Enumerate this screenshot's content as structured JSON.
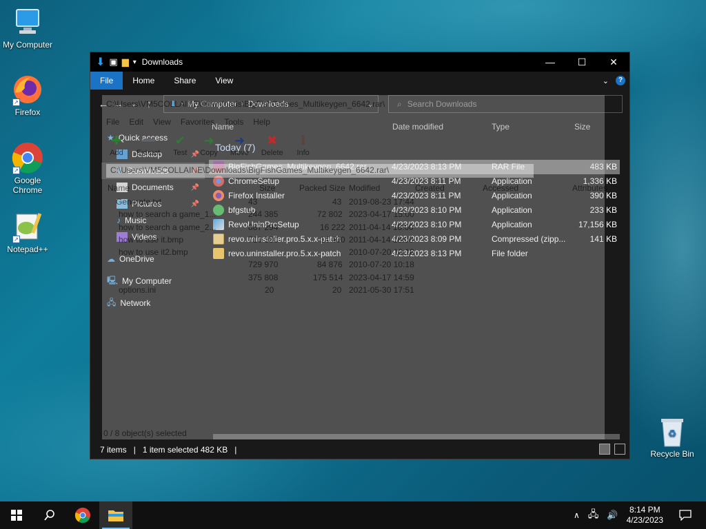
{
  "desktop": {
    "icons": [
      {
        "label": "My Computer"
      },
      {
        "label": "Firefox"
      },
      {
        "label": "Google Chrome"
      },
      {
        "label": "Notepad++"
      }
    ],
    "recycle_bin": "Recycle Bin"
  },
  "explorer": {
    "title": "Downloads",
    "tabs": [
      "File",
      "Home",
      "Share",
      "View"
    ],
    "breadcrumb": [
      "My Computer",
      "Downloads"
    ],
    "search_placeholder": "Search Downloads",
    "nav": [
      {
        "label": "Quick access",
        "pinned": false
      },
      {
        "label": "Desktop",
        "pinned": true
      },
      {
        "label": "Downloads",
        "pinned": true
      },
      {
        "label": "Documents",
        "pinned": true
      },
      {
        "label": "Pictures",
        "pinned": true
      },
      {
        "label": "Music",
        "pinned": false
      },
      {
        "label": "Videos",
        "pinned": false
      },
      {
        "label": "OneDrive",
        "pinned": false
      },
      {
        "label": "My Computer",
        "pinned": false
      },
      {
        "label": "Network",
        "pinned": false
      }
    ],
    "columns": {
      "name": "Name",
      "date": "Date modified",
      "type": "Type",
      "size": "Size"
    },
    "group": "Today (7)",
    "files": [
      {
        "name": "BigFishGames_Multikeygen_6642.rar",
        "date": "4/23/2023 8:13 PM",
        "type": "RAR File",
        "size": "483 KB",
        "icon": "rar-icon"
      },
      {
        "name": "ChromeSetup",
        "date": "4/23/2023 8:11 PM",
        "type": "Application",
        "size": "1,336 KB",
        "icon": "chrome-setup-icon"
      },
      {
        "name": "Firefox Installer",
        "date": "4/23/2023 8:11 PM",
        "type": "Application",
        "size": "390 KB",
        "icon": "firefox-installer-icon"
      },
      {
        "name": "bfgstub",
        "date": "4/23/2023 8:10 PM",
        "type": "Application",
        "size": "233 KB",
        "icon": "bfgstub-icon"
      },
      {
        "name": "RevoUninProSetup",
        "date": "4/23/2023 8:10 PM",
        "type": "Application",
        "size": "17,156 KB",
        "icon": "revo-setup-icon"
      },
      {
        "name": "revo.uninstaller.pro.5.x.x-patch",
        "date": "4/23/2023 8:09 PM",
        "type": "Compressed (zipp...",
        "size": "141 KB",
        "icon": "zip-folder-icon"
      },
      {
        "name": "revo.uninstaller.pro.5.x.x-patch",
        "date": "4/23/2023 8:13 PM",
        "type": "File folder",
        "size": "",
        "icon": "folder-icon"
      }
    ],
    "status": {
      "count": "7 items",
      "selected": "1 item selected  482 KB"
    }
  },
  "ghost": {
    "address": "C:\\Users\\VM5COLLAINE\\Downloads\\BigFishGames_Multikeygen_6642.rar\\",
    "menu": [
      "File",
      "Edit",
      "View",
      "Favorites",
      "Tools",
      "Help"
    ],
    "tools": [
      "Add",
      "Extract",
      "Test",
      "Copy",
      "Move",
      "Delete",
      "Info"
    ],
    "path": "C:\\Users\\VM5COLLAINE\\Downloads\\BigFishGames_Multikeygen_6642.rar\\",
    "headers": [
      "Name",
      "Size",
      "Packed Size",
      "Modified",
      "Created",
      "Accessed",
      "Attributes"
    ],
    "rows": [
      {
        "name": "Generate.txt",
        "size": "43",
        "packed": "43",
        "modified": "2019-08-23 17:44"
      },
      {
        "name": "how to search a game_1...",
        "size": "244 385",
        "packed": "72 802",
        "modified": "2023-04-17 15:00"
      },
      {
        "name": "how to search a game_2...",
        "size": "887 294",
        "packed": "16 222",
        "modified": "2011-04-14 18:00"
      },
      {
        "name": "how to use it.bmp",
        "size": "710 380",
        "packed": "14 400",
        "modified": "2011-04-14 18:00"
      },
      {
        "name": "how to use it2.bmp",
        "size": "",
        "packed": "",
        "modified": "2010-07-20 10:18"
      },
      {
        "name": "",
        "size": "729 970",
        "packed": "84 876",
        "modified": "2010-07-20 10:18"
      },
      {
        "name": "",
        "size": "375 808",
        "packed": "175 514",
        "modified": "2023-04-17 14:59"
      },
      {
        "name": "options.ini",
        "size": "20",
        "packed": "20",
        "modified": "2021-05-30 17:51"
      }
    ],
    "status": "0 / 8 object(s) selected"
  },
  "taskbar": {
    "time": "8:14 PM",
    "date": "4/23/2023"
  }
}
